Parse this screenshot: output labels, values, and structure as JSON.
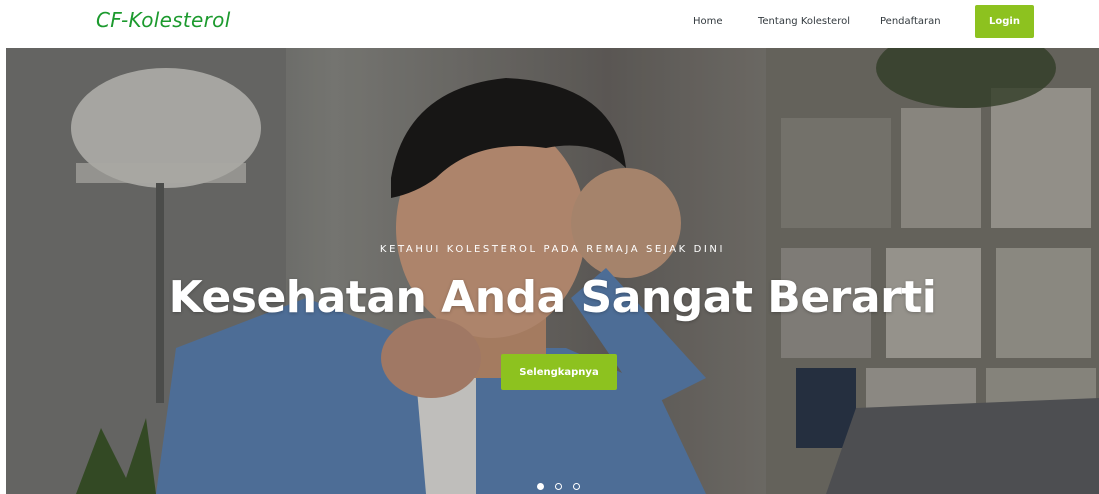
{
  "navbar": {
    "brand": "CF-Kolesterol",
    "links": [
      {
        "label": "Home"
      },
      {
        "label": "Tentang Kolesterol"
      },
      {
        "label": "Pendaftaran"
      }
    ],
    "login_label": "Login"
  },
  "hero": {
    "eyebrow": "KETAHUI KOLESTEROL PADA REMAJA SEJAK DINI",
    "title": "Kesehatan Anda Sangat Berarti",
    "cta_label": "Selengkapnya",
    "slide_count": 3,
    "active_slide": 1
  },
  "colors": {
    "brand": "#1c9a2e",
    "accent": "#8dc21f",
    "nav_text": "#333a3f"
  }
}
